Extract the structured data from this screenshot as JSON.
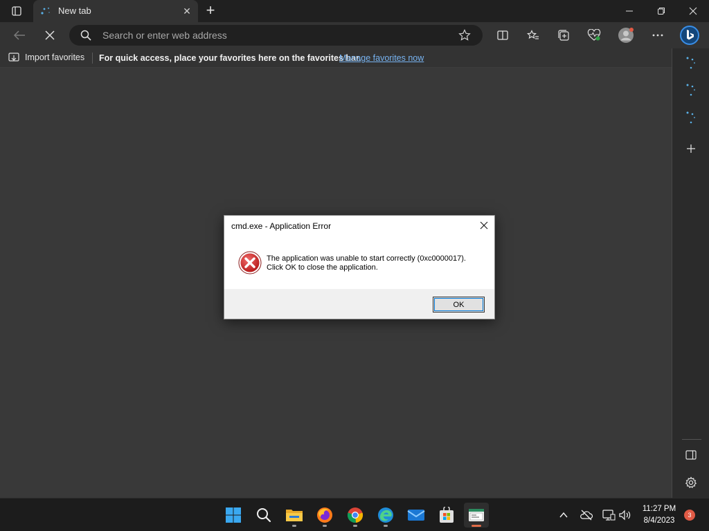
{
  "browser": {
    "tab": {
      "title": "New tab",
      "close_glyph": "✕"
    },
    "new_tab_glyph": "+",
    "address_bar": {
      "placeholder": "Search or enter web address",
      "value": ""
    },
    "favorites_bar": {
      "import_label": "Import favorites",
      "message": "For quick access, place your favorites here on the favorites bar.",
      "manage_link": "Manage favorites now"
    }
  },
  "dialog": {
    "title": "cmd.exe - Application Error",
    "message_line1": "The application was unable to start correctly (0xc0000017).",
    "message_line2": "Click OK to close the application.",
    "ok_label": "OK",
    "icon": "error-icon"
  },
  "taskbar": {
    "apps": [
      "start-icon",
      "search-icon",
      "file-explorer-icon",
      "firefox-icon",
      "chrome-icon",
      "edge-icon",
      "mail-icon",
      "store-icon",
      "cmd-icon"
    ],
    "clock": {
      "time": "11:27 PM",
      "date": "8/4/2023"
    },
    "notification_count": "3"
  },
  "colors": {
    "accent_link": "#78b4f2",
    "error_red": "#d42a2a",
    "taskbar_active": "#e06c48"
  }
}
